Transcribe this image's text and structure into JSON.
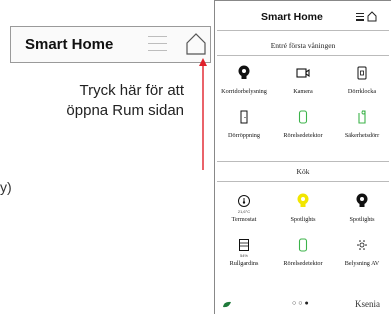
{
  "zoom": {
    "title": "Smart Home",
    "callout": "Tryck här för att öppna Rum sidan",
    "stray_text": "y)"
  },
  "phone": {
    "title": "Smart Home",
    "sections": [
      {
        "title": "Entré första våningen",
        "tiles": [
          {
            "label": "Korridorbelysning",
            "icon": "lightbulb-on-icon",
            "sub": ""
          },
          {
            "label": "Kamera",
            "icon": "camera-icon",
            "sub": ""
          },
          {
            "label": "Dörrklocka",
            "icon": "doorbell-icon",
            "sub": ""
          },
          {
            "label": "Dörröppning",
            "icon": "door-icon",
            "sub": ""
          },
          {
            "label": "Rörelsedetektor",
            "icon": "motion-sensor-icon",
            "sub": ""
          },
          {
            "label": "Säkerhetsdörr",
            "icon": "security-door-icon",
            "sub": ""
          }
        ]
      },
      {
        "title": "Kök",
        "tiles": [
          {
            "label": "Termostat",
            "icon": "thermostat-icon",
            "sub": "21,6°C"
          },
          {
            "label": "Spotlights",
            "icon": "lightbulb-yellow-icon",
            "sub": ""
          },
          {
            "label": "Spotlights",
            "icon": "lightbulb-on-icon",
            "sub": ""
          },
          {
            "label": "Rullgardins",
            "icon": "blinds-icon",
            "sub": "54%"
          },
          {
            "label": "Rörelsedetektor",
            "icon": "motion-sensor-icon",
            "sub": ""
          },
          {
            "label": "Belysning AV",
            "icon": "light-off-icon",
            "sub": ""
          }
        ]
      }
    ],
    "footer": {
      "brand": "Ksenia",
      "page_dots": "○○●"
    }
  },
  "colors": {
    "arrow": "#e0202a",
    "green": "#3cb34a",
    "yellow": "#f2e600",
    "leaf": "#1f7a3a"
  }
}
